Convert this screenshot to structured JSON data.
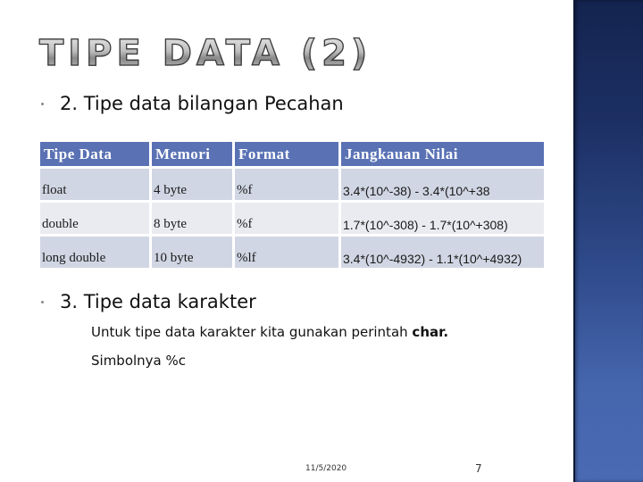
{
  "slide": {
    "title": "TIPE DATA (2)",
    "bullets": [
      {
        "text": "2. Tipe data bilangan Pecahan"
      },
      {
        "text": "3. Tipe data karakter"
      }
    ],
    "char_section": {
      "line1_prefix": "Untuk tipe data karakter kita gunakan perintah ",
      "line1_keyword": "char.",
      "line2": "Simbolnya %c"
    },
    "table": {
      "headers": [
        "Tipe Data",
        "Memori",
        "Format",
        "Jangkauan Nilai"
      ],
      "rows": [
        [
          "float",
          "4 byte",
          "%f",
          "3.4*(10^-38) - 3.4*(10^+38"
        ],
        [
          "double",
          "8 byte",
          "%f",
          "1.7*(10^-308) - 1.7*(10^+308)"
        ],
        [
          "long double",
          "10 byte",
          "%lf",
          "3.4*(10^-4932) - 1.1*(10^+4932)"
        ]
      ],
      "colors": {
        "header_bg": "#5a72b4",
        "row_odd_bg": "#d0d6e3",
        "row_even_bg": "#e9ebf1"
      }
    },
    "footer": {
      "date": "11/5/2020",
      "page_number": "7"
    },
    "theme": {
      "sidebar_top": "#142450",
      "sidebar_bottom": "#4a6bb4"
    }
  }
}
